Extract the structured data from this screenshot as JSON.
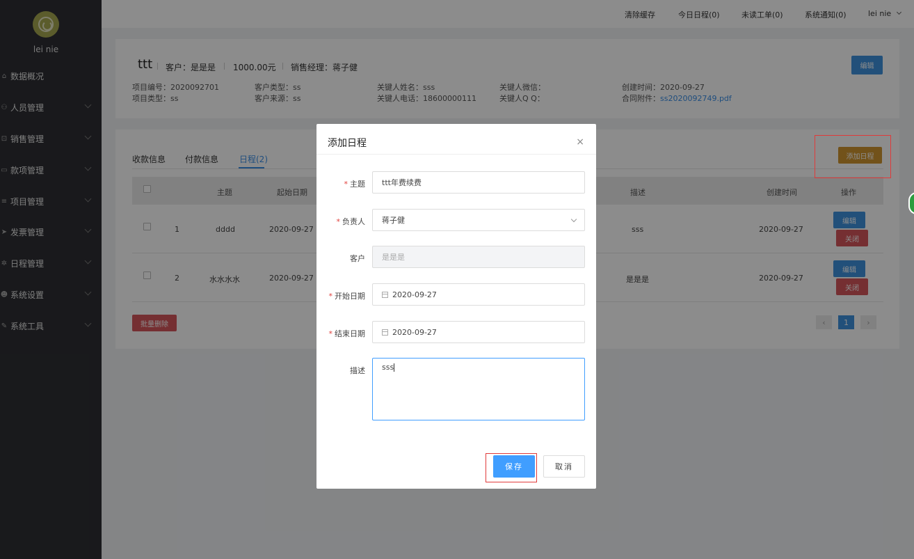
{
  "sidebar": {
    "username": "lei nie",
    "items": [
      {
        "icon": "home-icon",
        "glyph": "⌂",
        "label": "数据概况"
      },
      {
        "icon": "user-icon",
        "glyph": "⚇",
        "label": "人员管理"
      },
      {
        "icon": "cart-icon",
        "glyph": "⊡",
        "label": "销售管理"
      },
      {
        "icon": "money-icon",
        "glyph": "▭",
        "label": "款项管理"
      },
      {
        "icon": "list-icon",
        "glyph": "≡",
        "label": "项目管理"
      },
      {
        "icon": "send-icon",
        "glyph": "➤",
        "label": "发票管理"
      },
      {
        "icon": "gear-icon",
        "glyph": "✲",
        "label": "日程管理"
      },
      {
        "icon": "users-icon",
        "glyph": "☻",
        "label": "系统设置"
      },
      {
        "icon": "wrench-icon",
        "glyph": "✎",
        "label": "系统工具"
      }
    ]
  },
  "topbar": {
    "clear_cache": "清除缓存",
    "today_schedule": "今日日程(0)",
    "unread_tickets": "未读工单(0)",
    "notifications": "系统通知(0)",
    "user": "lei nie"
  },
  "project": {
    "title": "ttt",
    "customer": "客户：是是是",
    "amount": "1000.00元",
    "manager": "销售经理：蒋子健",
    "edit_label": "编辑",
    "meta": [
      "项目编号：2020092701",
      "客户类型：ss",
      "关键人姓名：sss",
      "关键人微信：",
      "创建时间：2020-09-27",
      "项目类型：ss",
      "客户来源：ss",
      "关键人电话：18600000111",
      "关键人Q Q：",
      "合同附件："
    ],
    "attachment": "ss2020092749.pdf"
  },
  "tabs": [
    "收款信息",
    "付款信息",
    "日程(2)"
  ],
  "add_schedule_label": "添加日程",
  "table": {
    "headers": [
      "主题",
      "起始日期",
      "描述",
      "创建时间",
      "操作"
    ],
    "rows": [
      {
        "index": "1",
        "subject": "dddd",
        "start": "2020-09-27",
        "desc": "sss",
        "created": "2020-09-27",
        "edit": "编辑",
        "close": "关闭"
      },
      {
        "index": "2",
        "subject": "水水水水",
        "start": "2020-09-27",
        "desc": "是是是",
        "created": "2020-09-27",
        "edit": "编辑",
        "close": "关闭"
      }
    ]
  },
  "batch_delete_label": "批量删除",
  "pagination": {
    "prev": "‹",
    "current": "1",
    "next": "›"
  },
  "modal": {
    "title": "添加日程",
    "close": "×",
    "fields": {
      "subject_label": "主题",
      "subject_value": "ttt年费续费",
      "owner_label": "负责人",
      "owner_value": "蒋子健",
      "customer_label": "客户",
      "customer_value": "是是是",
      "start_label": "开始日期",
      "start_value": "2020-09-27",
      "end_label": "结束日期",
      "end_value": "2020-09-27",
      "desc_label": "描述",
      "desc_value": "sss"
    },
    "required_mark": "*",
    "save": "保存",
    "cancel": "取消"
  }
}
